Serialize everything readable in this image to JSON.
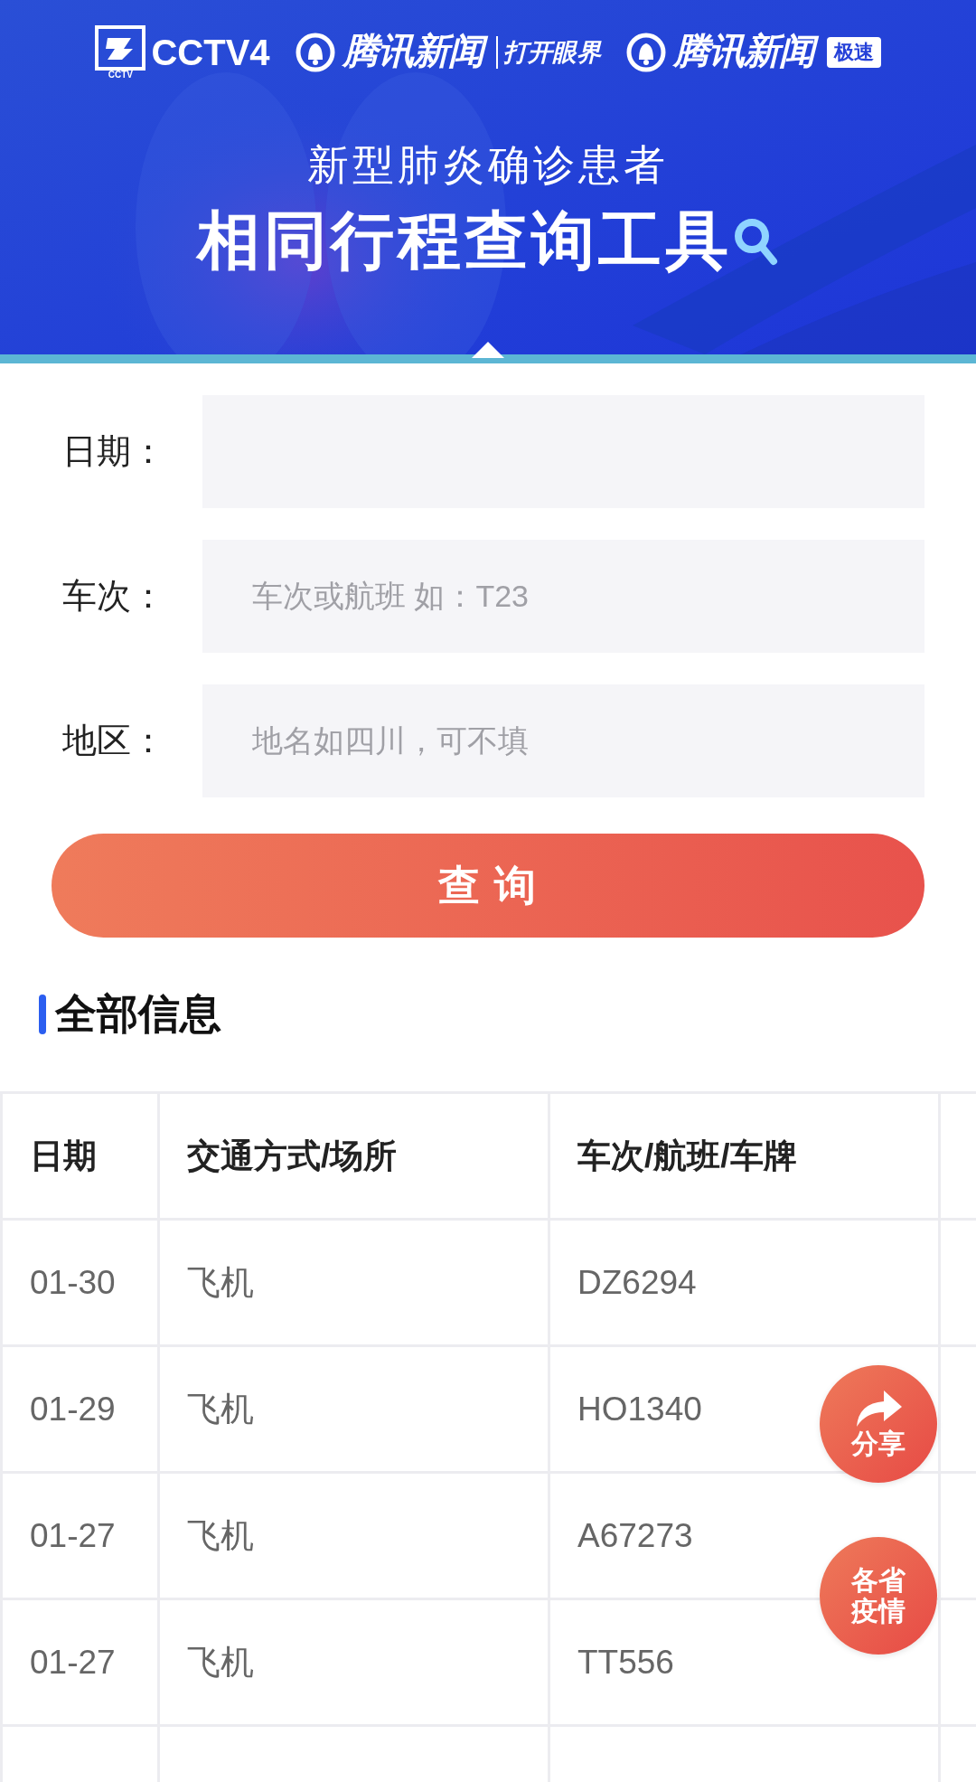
{
  "header": {
    "logos": [
      {
        "kind": "cctv",
        "text": "CCTV4",
        "subtext": "CCTV"
      },
      {
        "kind": "tencent",
        "text": "腾讯新闻",
        "tag": "打开眼界"
      },
      {
        "kind": "tencent-badge",
        "text": "腾讯新闻",
        "tag": "极速"
      }
    ],
    "subtitle": "新型肺炎确诊患者",
    "title": "相同行程查询工具"
  },
  "form": {
    "fields": [
      {
        "label": "日期："
      },
      {
        "label": "车次：",
        "placeholder": "车次或航班 如：T23"
      },
      {
        "label": "地区：",
        "placeholder": "地名如四川，可不填"
      }
    ],
    "submit": "查 询"
  },
  "section_title": "全部信息",
  "table": {
    "columns": [
      "日期",
      "交通方式/场所",
      "车次/航班/车牌"
    ],
    "rows": [
      [
        "01-30",
        "飞机",
        "DZ6294"
      ],
      [
        "01-29",
        "飞机",
        "HO1340"
      ],
      [
        "01-27",
        "飞机",
        "A67273"
      ],
      [
        "01-27",
        "飞机",
        "TT556"
      ]
    ]
  },
  "floating_buttons": [
    {
      "kind": "share",
      "label": "分享"
    },
    {
      "kind": "text",
      "label": "各省疫情"
    }
  ]
}
